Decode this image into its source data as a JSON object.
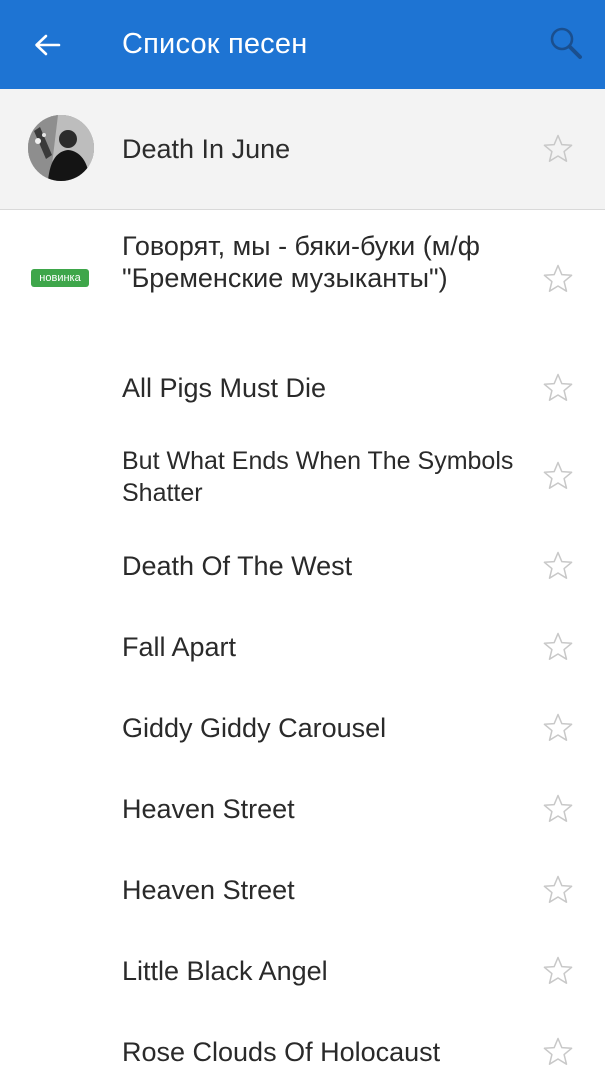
{
  "header": {
    "title": "Список песен",
    "back_icon": "arrow-left-icon",
    "search_icon": "search-icon",
    "color": "#1e74d3"
  },
  "artist": {
    "name": "Death In June"
  },
  "badge": {
    "label": "новинка",
    "color": "#3ea64a"
  },
  "songs": [
    {
      "title": "Говорят, мы - бяки-буки (м/ф \"Бременские музыканты\")",
      "is_new": true,
      "favorite": false
    },
    {
      "title": "All Pigs Must Die",
      "is_new": false,
      "favorite": false
    },
    {
      "title": "But What Ends When The Symbols Shatter",
      "is_new": false,
      "favorite": false
    },
    {
      "title": "Death Of The West",
      "is_new": false,
      "favorite": false
    },
    {
      "title": "Fall Apart",
      "is_new": false,
      "favorite": false
    },
    {
      "title": "Giddy Giddy Carousel",
      "is_new": false,
      "favorite": false
    },
    {
      "title": "Heaven Street",
      "is_new": false,
      "favorite": false
    },
    {
      "title": "Heaven Street",
      "is_new": false,
      "favorite": false
    },
    {
      "title": "Little Black Angel",
      "is_new": false,
      "favorite": false
    },
    {
      "title": "Rose Clouds Of Holocaust",
      "is_new": false,
      "favorite": false
    }
  ]
}
